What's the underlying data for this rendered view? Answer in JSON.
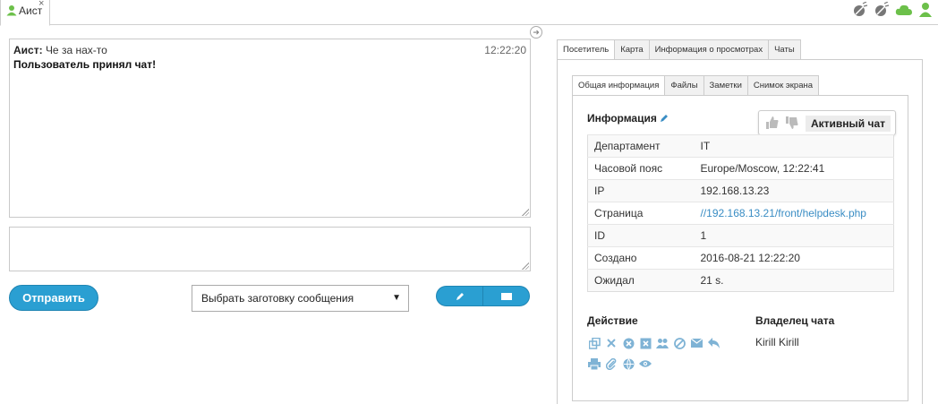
{
  "chat_tab": {
    "label": "Аист",
    "close": "×"
  },
  "messages": {
    "author": "Аист:",
    "text": "Че за нах-то",
    "time": "12:22:20",
    "system": "Пользователь принял чат!"
  },
  "composer": {
    "send_label": "Отправить",
    "canned_placeholder": "Выбрать заготовку сообщения"
  },
  "right_tabs": [
    "Посетитель",
    "Карта",
    "Информация о просмотрах",
    "Чаты"
  ],
  "sub_tabs": [
    "Общая информация",
    "Файлы",
    "Заметки",
    "Снимок экрана"
  ],
  "info": {
    "title": "Информация",
    "status": "Активный чат",
    "rows": [
      {
        "key": "Департамент",
        "value": "IT"
      },
      {
        "key": "Часовой пояс",
        "value": "Europe/Moscow, 12:22:41"
      },
      {
        "key": "IP",
        "value": "192.168.13.23"
      },
      {
        "key": "Страница",
        "value": "//192.168.13.21/front/helpdesk.php"
      },
      {
        "key": "ID",
        "value": "1"
      },
      {
        "key": "Создано",
        "value": "2016-08-21 12:22:20"
      },
      {
        "key": "Ожидал",
        "value": "21 s."
      }
    ]
  },
  "actions": {
    "title": "Действие"
  },
  "owner": {
    "title": "Владелец чата",
    "name": "Kirill Kirill"
  },
  "colors": {
    "accent": "#2a9fd2",
    "icon": "#7fb3d5",
    "online": "#6cc04a",
    "link": "#3a8dc4"
  }
}
